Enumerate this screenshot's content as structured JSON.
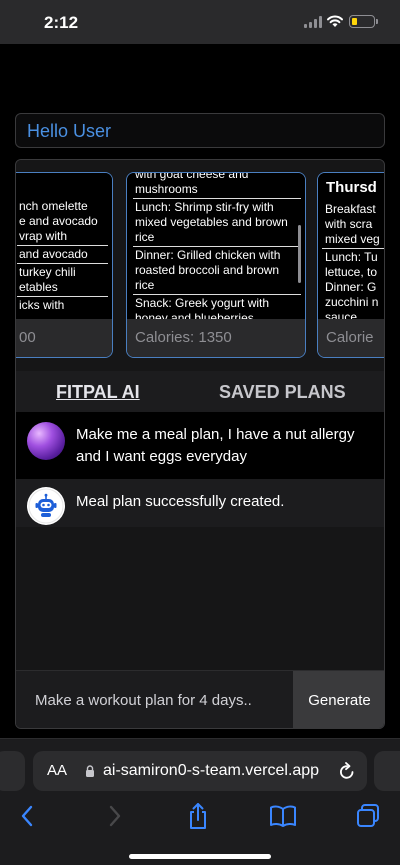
{
  "status_bar": {
    "time": "2:12"
  },
  "header": {
    "greeting": "Hello User"
  },
  "plans": [
    {
      "day": "",
      "meals": [
        "nch omelette",
        "e and avocado",
        "vrap with",
        "and avocado",
        "turkey chili",
        "etables",
        "icks with"
      ],
      "calories": "00"
    },
    {
      "day": "",
      "meals": [
        "with goat cheese and",
        "mushrooms",
        "Lunch: Shrimp stir-fry with",
        "mixed vegetables and brown",
        "rice",
        "Dinner: Grilled chicken with",
        "roasted broccoli and brown",
        "rice",
        "Snack: Greek yogurt with",
        "honey and blueberries"
      ],
      "calories": "Calories: 1350"
    },
    {
      "day": "Thursd",
      "meals": [
        "Breakfast",
        "with scra",
        "mixed veg",
        "Lunch: Tu",
        "lettuce, to",
        "Dinner: G",
        "zucchini n",
        "sauce"
      ],
      "calories": "Calorie"
    }
  ],
  "tabs": {
    "ai": "FITPAL AI",
    "saved": "SAVED PLANS"
  },
  "chat": {
    "user_message": "Make me a meal plan, I have a nut allergy and I want eggs everyday",
    "bot_message": "Meal plan successfully created."
  },
  "input": {
    "placeholder": "Make a workout plan for 4 days..",
    "generate_label": "Generate"
  },
  "browser": {
    "aa_label": "AA",
    "url": "ai-samiron0-s-team.vercel.app"
  },
  "colors": {
    "accent": "#4a90e2",
    "card_border": "#4a7fc1"
  }
}
